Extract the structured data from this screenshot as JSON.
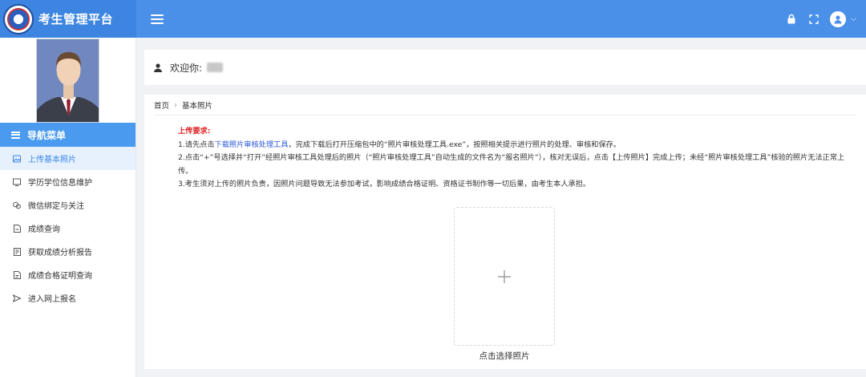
{
  "header": {
    "app_title": "考生管理平台",
    "colors": {
      "bar": "#4a90e8",
      "brand_bg": "#3d85e0"
    },
    "icons": [
      "menu-icon",
      "lock-icon",
      "fullscreen-icon",
      "user-avatar-icon",
      "chevron-down-icon"
    ]
  },
  "sidebar": {
    "nav_title": "导航菜单",
    "items": [
      {
        "label": "上传基本照片",
        "icon": "image-icon",
        "active": true
      },
      {
        "label": "学历学位信息维护",
        "icon": "book-icon",
        "active": false
      },
      {
        "label": "微信绑定与关注",
        "icon": "wechat-icon",
        "active": false
      },
      {
        "label": "成绩查询",
        "icon": "document-icon",
        "active": false
      },
      {
        "label": "获取成绩分析报告",
        "icon": "report-icon",
        "active": false
      },
      {
        "label": "成绩合格证明查询",
        "icon": "certificate-icon",
        "active": false
      },
      {
        "label": "进入网上报名",
        "icon": "send-icon",
        "active": false
      }
    ],
    "colors": {
      "nav_header": "#4a9bf0",
      "active_bg": "#e6f1fd",
      "active_text": "#3a86e6"
    }
  },
  "welcome": {
    "text": "欢迎你:"
  },
  "breadcrumb": {
    "home": "首页",
    "current": "基本照片"
  },
  "requirements": {
    "title": "上传要求:",
    "line1_prefix": "1.请先点击",
    "line1_link": "下载照片审核处理工具",
    "line1_suffix": "，完成下载后打开压缩包中的“照片审核处理工具.exe”，按照相关提示进行照片的处理、审核和保存。",
    "line2": "2.点击“+”号选择并“打开”经照片审核工具处理后的照片（“照片审核处理工具”自动生成的文件名为“报名照片”），核对无误后，点击【上传照片】完成上传；未经“照片审核处理工具”核验的照片无法正常上传。",
    "line3": "3.考生须对上传的照片负责，因照片问题导致无法参加考试，影响成绩合格证明、资格证书制作等一切后果，由考生本人承担。",
    "colors": {
      "title": "#e02020",
      "link": "#2b57d8"
    }
  },
  "upload": {
    "caption": "点击选择照片",
    "icon": "plus-icon"
  }
}
